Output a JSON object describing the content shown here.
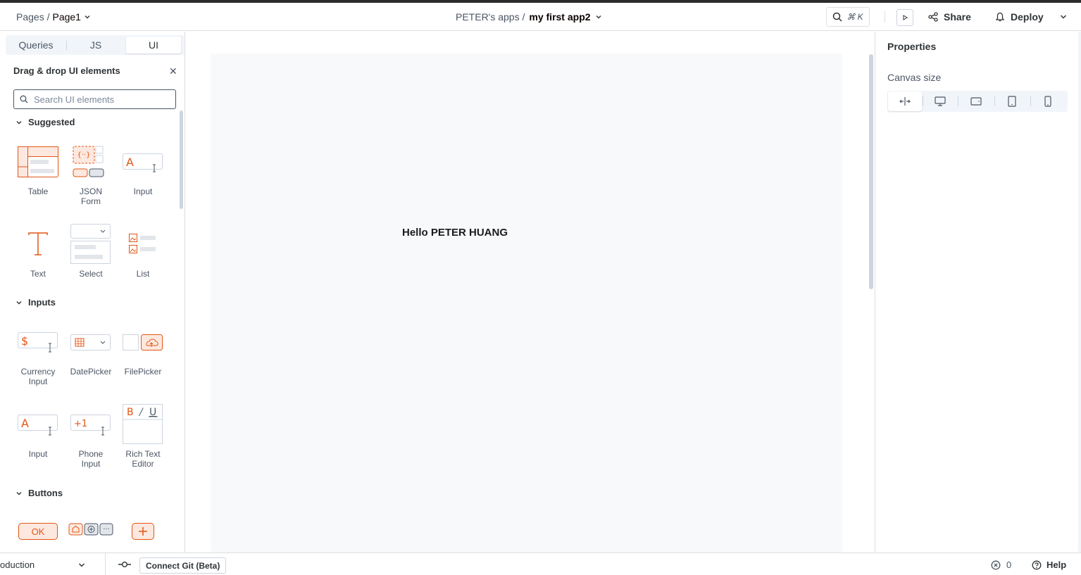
{
  "header": {
    "breadcrumb_root": "Pages /",
    "breadcrumb_page": "Page1",
    "workspace": "PETER's apps /",
    "app_name": "my first app2",
    "shortcut": "⌘ K",
    "share_label": "Share",
    "deploy_label": "Deploy"
  },
  "sidebar": {
    "tabs": [
      "Queries",
      "JS",
      "UI"
    ],
    "active_tab": "UI",
    "panel_title": "Drag & drop UI elements",
    "search_placeholder": "Search UI elements",
    "sections": [
      {
        "title": "Suggested",
        "widgets": [
          {
            "label": "Table",
            "icon": "table-widget-icon"
          },
          {
            "label": "JSON Form",
            "icon": "json-form-widget-icon"
          },
          {
            "label": "Input",
            "icon": "input-widget-icon"
          },
          {
            "label": "Text",
            "icon": "text-widget-icon"
          },
          {
            "label": "Select",
            "icon": "select-widget-icon"
          },
          {
            "label": "List",
            "icon": "list-widget-icon"
          }
        ]
      },
      {
        "title": "Inputs",
        "widgets": [
          {
            "label": "Currency Input",
            "icon": "currency-input-widget-icon"
          },
          {
            "label": "DatePicker",
            "icon": "datepicker-widget-icon"
          },
          {
            "label": "FilePicker",
            "icon": "filepicker-widget-icon"
          },
          {
            "label": "Input",
            "icon": "input-widget-icon"
          },
          {
            "label": "Phone Input",
            "icon": "phone-input-widget-icon"
          },
          {
            "label": "Rich Text Editor",
            "icon": "rich-text-editor-widget-icon"
          }
        ]
      },
      {
        "title": "Buttons",
        "widgets": [
          {
            "label": "",
            "icon": "button-widget-icon",
            "text": "OK"
          },
          {
            "label": "",
            "icon": "button-group-widget-icon"
          },
          {
            "label": "",
            "icon": "icon-button-widget-icon"
          }
        ]
      }
    ]
  },
  "canvas": {
    "text": "Hello PETER HUANG"
  },
  "properties": {
    "title": "Properties",
    "canvas_size_label": "Canvas size",
    "size_options": [
      "fluid-width-icon",
      "desktop-icon",
      "tablet-landscape-icon",
      "tablet-portrait-icon",
      "mobile-icon"
    ],
    "active_size": "fluid-width-icon"
  },
  "footer": {
    "environment": "oduction",
    "git_button": "Connect Git (Beta)",
    "error_count": "0",
    "help_label": "Help"
  },
  "colors": {
    "accent": "#e15615",
    "accent_light": "#fde8df",
    "text": "#4c5664",
    "border": "#e0dede"
  }
}
